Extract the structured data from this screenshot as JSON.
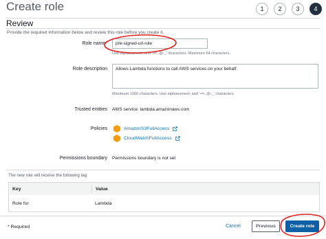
{
  "header": {
    "title": "Create role",
    "steps": [
      "1",
      "2",
      "3",
      "4"
    ],
    "active_step": "4"
  },
  "review": {
    "section_title": "Review",
    "intro": "Provide the required information below and review this role before you create it."
  },
  "role_name": {
    "label": "Role name*",
    "value": "pre-signed-url-role",
    "hint": "Use alphanumeric and '+=,.@-_' characters. Maximum 64 characters."
  },
  "role_description": {
    "label": "Role description",
    "value": "Allows Lambda functions to call AWS services on your behalf.",
    "hint": "Maximum 1000 characters. Use alphanumeric and '+=,.@-_' characters."
  },
  "trusted_entities": {
    "label": "Trusted entities",
    "value": "AWS service: lambda.amazonaws.com"
  },
  "policies": {
    "label": "Policies",
    "items": [
      {
        "name": "AmazonS3FullAccess",
        "icon": "policy-cube-icon"
      },
      {
        "name": "CloudWatchFullAccess",
        "icon": "policy-cube-icon"
      }
    ]
  },
  "permissions_boundary": {
    "label": "Permissions boundary",
    "value": "Permissions boundary is not set"
  },
  "tags": {
    "note": "The new role will receive the following tag",
    "columns": [
      "Key",
      "Value"
    ],
    "rows": [
      {
        "key": "Role for",
        "value": "Lambda"
      }
    ]
  },
  "footer": {
    "required": "* Required",
    "cancel": "Cancel",
    "previous": "Previous",
    "create": "Create role"
  },
  "colors": {
    "primary_button": "#0d5fa6",
    "link": "#0073bb",
    "annotation": "#e0201c",
    "policy_icon": "#f39c12"
  }
}
